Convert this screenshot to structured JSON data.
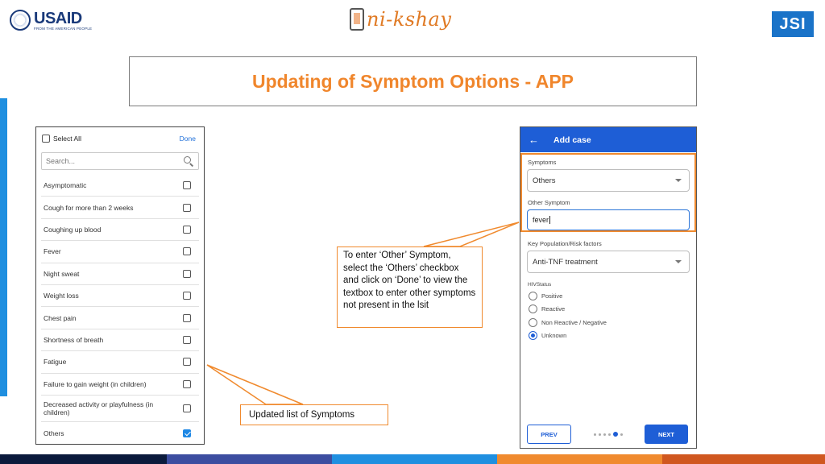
{
  "header": {
    "usaid_word": "USAID",
    "usaid_sub": "FROM THE AMERICAN PEOPLE",
    "nikshay_word": "ni-kshay",
    "jsi_word": "JSI"
  },
  "slide": {
    "title": "Updating of Symptom Options - APP",
    "title_color": "#f0862c",
    "accent_color": "#f08a2e"
  },
  "symptom_list": {
    "select_all_label": "Select All",
    "done_label": "Done",
    "search_placeholder": "Search...",
    "items": [
      {
        "label": "Asymptomatic",
        "checked": false
      },
      {
        "label": "Cough for more than 2 weeks",
        "checked": false
      },
      {
        "label": "Coughing up blood",
        "checked": false
      },
      {
        "label": "Fever",
        "checked": false
      },
      {
        "label": "Night sweat",
        "checked": false
      },
      {
        "label": "Weight loss",
        "checked": false
      },
      {
        "label": "Chest pain",
        "checked": false
      },
      {
        "label": "Shortness of breath",
        "checked": false
      },
      {
        "label": "Fatigue",
        "checked": false
      },
      {
        "label": "Failure to gain weight (in children)",
        "checked": false
      },
      {
        "label": "Decreased activity or playfulness (in children)",
        "checked": false
      },
      {
        "label": "Others",
        "checked": true
      }
    ]
  },
  "add_case": {
    "title": "Add case",
    "symptoms_label": "Symptoms",
    "symptoms_value": "Others",
    "other_symptom_label": "Other Symptom",
    "other_symptom_value": "fever",
    "key_population_label": "Key Population/Risk factors",
    "key_population_value": "Anti-TNF treatment",
    "hiv_status_label": "HIVStatus",
    "hiv_options": [
      {
        "label": "Positive",
        "selected": false
      },
      {
        "label": "Reactive",
        "selected": false
      },
      {
        "label": "Non Reactive / Negative",
        "selected": false
      },
      {
        "label": "Unknown",
        "selected": true
      }
    ],
    "prev_label": "PREV",
    "next_label": "NEXT",
    "brand_color": "#1e5ed6"
  },
  "callouts": {
    "other_symptom_note": "To enter ‘Other’ Symptom, select the ‘Others’ checkbox and click on ‘Done’ to view the textbox to enter other symptoms not present in the lsit",
    "list_note": "Updated list of Symptoms"
  },
  "footer_colors": [
    "#0b1a3c",
    "#3c4da0",
    "#1f8fe0",
    "#f08a2e",
    "#d0571f"
  ]
}
